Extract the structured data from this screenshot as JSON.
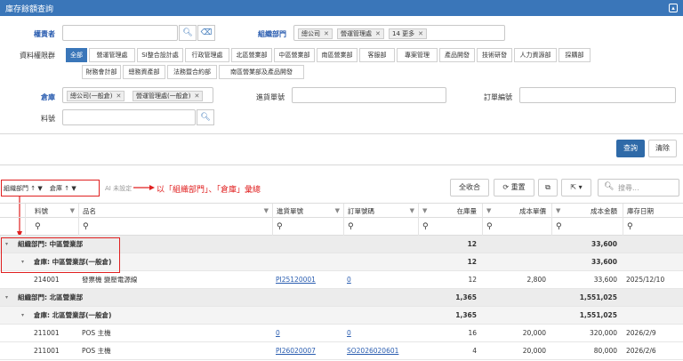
{
  "window": {
    "title": "庫存餘額查詢"
  },
  "form": {
    "acct_label": "權責者",
    "dept_label": "組織部門",
    "dept_chips": [
      "總公司",
      "營運管理處",
      "14 更多"
    ],
    "perm_label": "資料權限群",
    "perm_tabs_row1": [
      "全部",
      "營運管理處",
      "SI整合設計處",
      "行政管理處",
      "北區營業部",
      "中區營業部",
      "南區營業部",
      "客服部",
      "專案管理",
      "產品開發",
      "技術研發",
      "人力資源部",
      "採購部"
    ],
    "perm_tabs_row2": [
      "財務會計部",
      "總務資產部",
      "法務暨合約部",
      "南區營業部及產品開發"
    ],
    "warehouse_label": "倉庫",
    "warehouse_chips": [
      "總公司(一般倉)",
      "營運管理處(一般倉)"
    ],
    "inbound_label": "進貨單號",
    "order_label": "訂單編號",
    "part_label": "料號",
    "query_btn": "查詢",
    "clear_btn": "清除"
  },
  "groupbar": {
    "chip1": "組織部門",
    "chip2": "倉庫",
    "ai": "AI 未設定",
    "annotation": "以「組織部門」、「倉庫」彙總",
    "collapse_all": "全收合",
    "reset": "重置",
    "search_placeholder": "搜尋..."
  },
  "grid": {
    "headers": [
      "料號",
      "品名",
      "進貨單號",
      "訂單號碼",
      "在庫量",
      "成本單價",
      "成本金額",
      "庫存日期"
    ],
    "rows": [
      {
        "type": "g1",
        "label": "組織部門: 中區營業部",
        "qty": "12",
        "amount": "33,600"
      },
      {
        "type": "g2",
        "label": "倉庫: 中區營業部(一般倉)",
        "qty": "12",
        "amount": "33,600"
      },
      {
        "type": "d",
        "part": "214001",
        "name": "發票機 變壓電源線",
        "inbound": "PI25120001",
        "order": "0",
        "qty": "12",
        "unit": "2,800",
        "amount": "33,600",
        "date": "2025/12/10"
      },
      {
        "type": "g1",
        "label": "組織部門: 北區營業部",
        "qty": "1,365",
        "amount": "1,551,025"
      },
      {
        "type": "g2",
        "label": "倉庫: 北區營業部(一般倉)",
        "qty": "1,365",
        "amount": "1,551,025"
      },
      {
        "type": "d",
        "part": "211001",
        "name": "POS 主機",
        "inbound": "0",
        "order": "0",
        "qty": "16",
        "unit": "20,000",
        "amount": "320,000",
        "date": "2026/2/9"
      },
      {
        "type": "d",
        "part": "211001",
        "name": "POS 主機",
        "inbound": "PI26020007",
        "order": "SO2026020601",
        "qty": "4",
        "unit": "20,000",
        "amount": "80,000",
        "date": "2026/2/6"
      }
    ]
  }
}
